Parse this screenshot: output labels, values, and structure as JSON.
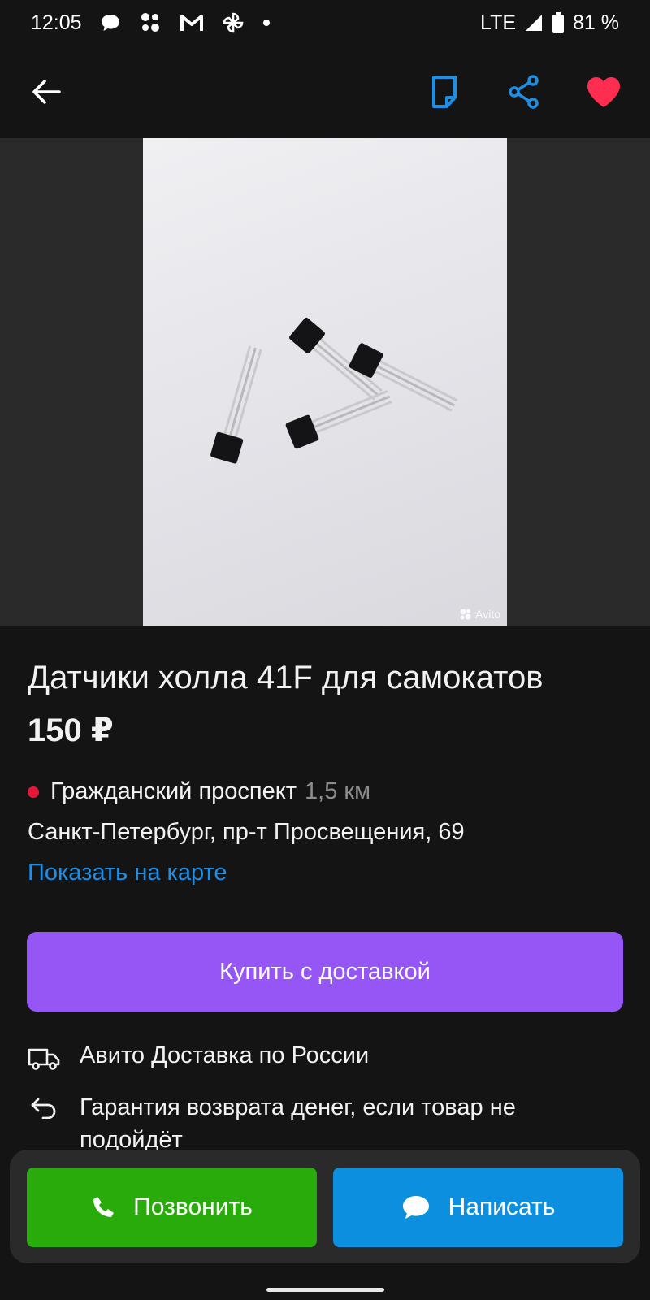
{
  "status_bar": {
    "time": "12:05",
    "network": "LTE",
    "battery": "81 %"
  },
  "app_bar": {
    "icons": [
      "back-arrow-icon",
      "note-icon",
      "share-icon",
      "heart-icon"
    ],
    "colors": {
      "note": "#1e8fe6",
      "share": "#1e8fe6",
      "heart": "#ff2d4f"
    }
  },
  "gallery": {
    "watermark": "Avito"
  },
  "listing": {
    "title": "Датчики холла 41F для самокатов",
    "price": "150 ₽",
    "metro": "Гражданский проспект",
    "metro_distance": "1,5 км",
    "address": "Санкт-Петербург, пр-т Просвещения, 69",
    "map_link": "Показать на карте"
  },
  "buy_button": {
    "label": "Купить с доставкой",
    "color": "#9556f5"
  },
  "features": {
    "delivery": "Авито Доставка по России",
    "refund": "Гарантия возврата денег, если товар не подойдёт"
  },
  "actions": {
    "call_label": "Позвонить",
    "call_color": "#2aab0c",
    "message_label": "Написать",
    "message_color": "#0b8fde"
  }
}
